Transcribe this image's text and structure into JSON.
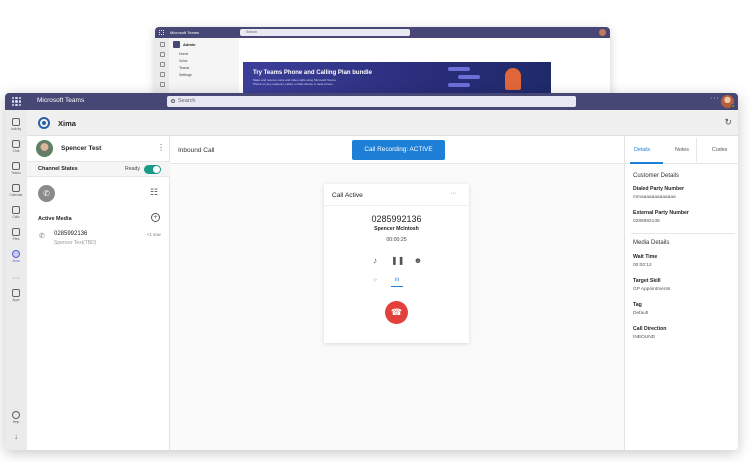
{
  "back_window": {
    "app_title": "Microsoft Teams",
    "search_placeholder": "Search",
    "sidebar_title": "Admin",
    "items": [
      "Home",
      "Voice",
      "Teams",
      "Settings"
    ],
    "banner_title": "Try Teams Phone and Calling Plan bundle",
    "banner_subtitle": "Make and receive voice and video calls using Microsoft Teams Phone on any endpoint, tablet, mobile device or desk phone."
  },
  "topbar": {
    "app_title": "Microsoft Teams",
    "search_placeholder": "Search",
    "more": "···"
  },
  "rail": {
    "items": [
      {
        "label": "Activity",
        "icon": "bell-icon"
      },
      {
        "label": "Chat",
        "icon": "chat-icon"
      },
      {
        "label": "Teams",
        "icon": "teams-icon"
      },
      {
        "label": "Calendar",
        "icon": "calendar-icon"
      },
      {
        "label": "Calls",
        "icon": "phone-icon"
      },
      {
        "label": "Files",
        "icon": "file-icon"
      },
      {
        "label": "Xima",
        "icon": "xima-icon"
      },
      {
        "label": "···",
        "icon": "more-icon"
      },
      {
        "label": "Apps",
        "icon": "apps-icon"
      },
      {
        "label": "Help",
        "icon": "help-icon"
      },
      {
        "label": "",
        "icon": "download-icon"
      }
    ]
  },
  "app": {
    "name": "Xima",
    "accent": "#1e7fd6"
  },
  "agent": {
    "name": "Spencer Test",
    "more": "⋮"
  },
  "channel_states": {
    "title": "Channel States",
    "status": "Ready",
    "toggle_on": true,
    "toggle_color": "#1b9a8a"
  },
  "active_media": {
    "title": "Active Media",
    "items": [
      {
        "number": "0285992136",
        "name": "Spencer Test(TBD)",
        "time": "<1 now"
      }
    ]
  },
  "center": {
    "call_type": "Inbound Call",
    "recording_button": "Call Recording: ACTIVE",
    "card": {
      "title": "Call Active",
      "more": "···",
      "number": "0285992136",
      "caller_name": "Spencer McIntosh",
      "timer": "00:00:25",
      "hangup_color": "#e2403a"
    }
  },
  "details": {
    "tabs": [
      "Details",
      "Notes",
      "Codes"
    ],
    "active_tab": "Details",
    "customer_section": "Customer Details",
    "fields": [
      {
        "label": "Dialed Party Number",
        "value": "mmaaaaaaaaaaaaa"
      },
      {
        "label": "External Party Number",
        "value": "0285992136"
      }
    ],
    "media_section": "Media Details",
    "media_fields": [
      {
        "label": "Wait Time",
        "value": "00:00:12"
      },
      {
        "label": "Target Skill",
        "value": "GP Appointments"
      },
      {
        "label": "Tag",
        "value": "Default"
      },
      {
        "label": "Call Direction",
        "value": "INBOUND"
      }
    ]
  }
}
